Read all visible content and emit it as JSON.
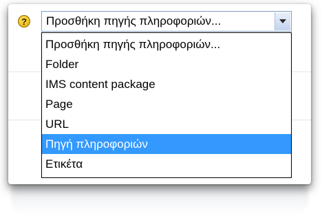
{
  "help_icon": {
    "glyph": "?",
    "color": "#f2c200"
  },
  "select": {
    "value": "Προσθήκη πηγής πληροφοριών...",
    "options": [
      "Προσθήκη πηγής πληροφοριών...",
      "Folder",
      "IMS content package",
      "Page",
      "URL",
      "Πηγή πληροφοριών",
      "Ετικέτα"
    ],
    "highlighted_index": 5,
    "highlight_color": "#3399ff"
  }
}
